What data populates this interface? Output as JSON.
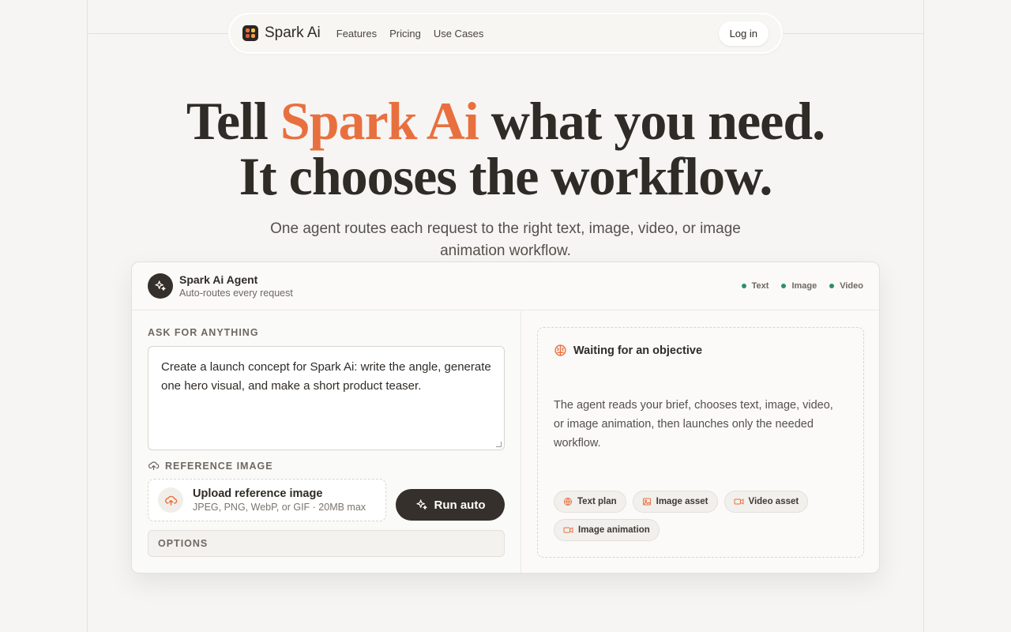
{
  "nav": {
    "brand": "Spark Ai",
    "links": [
      "Features",
      "Pricing",
      "Use Cases"
    ],
    "login": "Log in"
  },
  "hero": {
    "title_part1": "Tell ",
    "title_accent": "Spark Ai",
    "title_part2": " what you need.",
    "title_line2": "It chooses the workflow.",
    "subtitle": "One agent routes each request to the right text, image, video, or image animation workflow."
  },
  "agent": {
    "name": "Spark Ai Agent",
    "description": "Auto-routes every request",
    "statuses": [
      "Text",
      "Image",
      "Video"
    ],
    "status_color": "#2e8f6a"
  },
  "form": {
    "ask_label": "ASK FOR ANYTHING",
    "prompt_value": "Create a launch concept for Spark Ai: write the angle, generate one hero visual, and make a short product teaser.",
    "reference_label": "REFERENCE IMAGE",
    "upload_title": "Upload reference image",
    "upload_hint": "JPEG, PNG, WebP, or GIF · 20MB max",
    "run_label": "Run auto",
    "options_label": "OPTIONS"
  },
  "output": {
    "title": "Waiting for an objective",
    "description": "The agent reads your brief, chooses text, image, video, or image animation, then launches only the needed workflow.",
    "chips": [
      {
        "label": "Text plan",
        "icon": "globe-icon"
      },
      {
        "label": "Image asset",
        "icon": "image-icon"
      },
      {
        "label": "Video asset",
        "icon": "video-icon"
      },
      {
        "label": "Image animation",
        "icon": "video-icon"
      }
    ]
  },
  "colors": {
    "accent": "#e8703f",
    "dark": "#35302b",
    "background": "#f6f5f3"
  }
}
